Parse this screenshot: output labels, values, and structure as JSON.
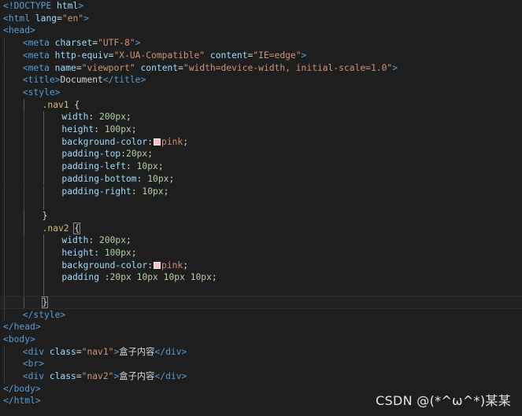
{
  "editor": {
    "theme_background": "#1e1e1e",
    "watermark": "CSDN @(*^ω^*)某某",
    "lines": [
      {
        "indent": 0,
        "tokens": [
          [
            "bracket",
            "<"
          ],
          [
            "doctype",
            "!DOCTYPE"
          ],
          [
            "txt",
            " "
          ],
          [
            "attr",
            "html"
          ],
          [
            "bracket",
            ">"
          ]
        ]
      },
      {
        "indent": 0,
        "tokens": [
          [
            "bracket",
            "<"
          ],
          [
            "tag",
            "html"
          ],
          [
            "txt",
            " "
          ],
          [
            "attr",
            "lang"
          ],
          [
            "txt",
            "="
          ],
          [
            "str",
            "\"en\""
          ],
          [
            "bracket",
            ">"
          ]
        ]
      },
      {
        "indent": 0,
        "tokens": [
          [
            "bracket",
            "<"
          ],
          [
            "tag",
            "head"
          ],
          [
            "bracket",
            ">"
          ]
        ]
      },
      {
        "indent": 1,
        "tokens": [
          [
            "bracket",
            "<"
          ],
          [
            "tag",
            "meta"
          ],
          [
            "txt",
            " "
          ],
          [
            "attr",
            "charset"
          ],
          [
            "txt",
            "="
          ],
          [
            "str",
            "\"UTF-8\""
          ],
          [
            "bracket",
            ">"
          ]
        ]
      },
      {
        "indent": 1,
        "tokens": [
          [
            "bracket",
            "<"
          ],
          [
            "tag",
            "meta"
          ],
          [
            "txt",
            " "
          ],
          [
            "attr",
            "http-equiv"
          ],
          [
            "txt",
            "="
          ],
          [
            "str",
            "\"X-UA-Compatible\""
          ],
          [
            "txt",
            " "
          ],
          [
            "attr",
            "content"
          ],
          [
            "txt",
            "="
          ],
          [
            "str",
            "\"IE=edge\""
          ],
          [
            "bracket",
            ">"
          ]
        ]
      },
      {
        "indent": 1,
        "tokens": [
          [
            "bracket",
            "<"
          ],
          [
            "tag",
            "meta"
          ],
          [
            "txt",
            " "
          ],
          [
            "attr",
            "name"
          ],
          [
            "txt",
            "="
          ],
          [
            "str",
            "\"viewport\""
          ],
          [
            "txt",
            " "
          ],
          [
            "attr",
            "content"
          ],
          [
            "txt",
            "="
          ],
          [
            "str",
            "\"width=device-width, initial-scale=1.0\""
          ],
          [
            "bracket",
            ">"
          ]
        ]
      },
      {
        "indent": 1,
        "tokens": [
          [
            "bracket",
            "<"
          ],
          [
            "tag",
            "title"
          ],
          [
            "bracket",
            ">"
          ],
          [
            "txt",
            "Document"
          ],
          [
            "bracket",
            "</"
          ],
          [
            "tag",
            "title"
          ],
          [
            "bracket",
            ">"
          ]
        ]
      },
      {
        "indent": 1,
        "tokens": [
          [
            "bracket",
            "<"
          ],
          [
            "tag",
            "style"
          ],
          [
            "bracket",
            ">"
          ]
        ]
      },
      {
        "indent": 2,
        "tokens": [
          [
            "sel",
            ".nav1"
          ],
          [
            "txt",
            " {"
          ]
        ]
      },
      {
        "indent": 3,
        "tokens": [
          [
            "prop",
            "width"
          ],
          [
            "txt",
            ": "
          ],
          [
            "num",
            "200px"
          ],
          [
            "txt",
            ";"
          ]
        ]
      },
      {
        "indent": 3,
        "tokens": [
          [
            "prop",
            "height"
          ],
          [
            "txt",
            ": "
          ],
          [
            "num",
            "100px"
          ],
          [
            "txt",
            ";"
          ]
        ]
      },
      {
        "indent": 3,
        "tokens": [
          [
            "prop",
            "background-color"
          ],
          [
            "txt",
            ":"
          ],
          [
            "swatch",
            "#ffc0cb"
          ],
          [
            "val",
            "pink"
          ],
          [
            "txt",
            ";"
          ]
        ]
      },
      {
        "indent": 3,
        "tokens": [
          [
            "prop",
            "padding-top"
          ],
          [
            "txt",
            ":"
          ],
          [
            "num",
            "20px"
          ],
          [
            "txt",
            ";"
          ]
        ]
      },
      {
        "indent": 3,
        "tokens": [
          [
            "prop",
            "padding-left"
          ],
          [
            "txt",
            ": "
          ],
          [
            "num",
            "10px"
          ],
          [
            "txt",
            ";"
          ]
        ]
      },
      {
        "indent": 3,
        "tokens": [
          [
            "prop",
            "padding-bottom"
          ],
          [
            "txt",
            ": "
          ],
          [
            "num",
            "10px"
          ],
          [
            "txt",
            ";"
          ]
        ]
      },
      {
        "indent": 3,
        "tokens": [
          [
            "prop",
            "padding-right"
          ],
          [
            "txt",
            ": "
          ],
          [
            "num",
            "10px"
          ],
          [
            "txt",
            ";"
          ]
        ]
      },
      {
        "indent": 3,
        "tokens": []
      },
      {
        "indent": 2,
        "tokens": [
          [
            "txt",
            "}"
          ]
        ]
      },
      {
        "indent": 2,
        "tokens": [
          [
            "sel",
            ".nav2"
          ],
          [
            "txt",
            " "
          ],
          [
            "match",
            "{"
          ]
        ]
      },
      {
        "indent": 3,
        "tokens": [
          [
            "prop",
            "width"
          ],
          [
            "txt",
            ": "
          ],
          [
            "num",
            "200px"
          ],
          [
            "txt",
            ";"
          ]
        ]
      },
      {
        "indent": 3,
        "tokens": [
          [
            "prop",
            "height"
          ],
          [
            "txt",
            ": "
          ],
          [
            "num",
            "100px"
          ],
          [
            "txt",
            ";"
          ]
        ]
      },
      {
        "indent": 3,
        "tokens": [
          [
            "prop",
            "background-color"
          ],
          [
            "txt",
            ":"
          ],
          [
            "swatch",
            "#ffc0cb"
          ],
          [
            "val",
            "pink"
          ],
          [
            "txt",
            ";"
          ]
        ]
      },
      {
        "indent": 3,
        "tokens": [
          [
            "prop",
            "padding"
          ],
          [
            "txt",
            " :"
          ],
          [
            "num",
            "20px"
          ],
          [
            "txt",
            " "
          ],
          [
            "num",
            "10px"
          ],
          [
            "txt",
            " "
          ],
          [
            "num",
            "10px"
          ],
          [
            "txt",
            " "
          ],
          [
            "num",
            "10px"
          ],
          [
            "txt",
            ";"
          ]
        ]
      },
      {
        "indent": 3,
        "tokens": []
      },
      {
        "indent": 2,
        "active": true,
        "tokens": [
          [
            "match",
            "}"
          ]
        ]
      },
      {
        "indent": 1,
        "tokens": [
          [
            "bracket",
            "</"
          ],
          [
            "tag",
            "style"
          ],
          [
            "bracket",
            ">"
          ]
        ]
      },
      {
        "indent": 0,
        "tokens": [
          [
            "bracket",
            "</"
          ],
          [
            "tag",
            "head"
          ],
          [
            "bracket",
            ">"
          ]
        ]
      },
      {
        "indent": 0,
        "tokens": [
          [
            "bracket",
            "<"
          ],
          [
            "tag",
            "body"
          ],
          [
            "bracket",
            ">"
          ]
        ]
      },
      {
        "indent": 1,
        "tokens": [
          [
            "bracket",
            "<"
          ],
          [
            "tag",
            "div"
          ],
          [
            "txt",
            " "
          ],
          [
            "attr",
            "class"
          ],
          [
            "txt",
            "="
          ],
          [
            "str",
            "\"nav1\""
          ],
          [
            "bracket",
            ">"
          ],
          [
            "txt",
            "盒子内容"
          ],
          [
            "bracket",
            "</"
          ],
          [
            "tag",
            "div"
          ],
          [
            "bracket",
            ">"
          ]
        ]
      },
      {
        "indent": 1,
        "tokens": [
          [
            "bracket",
            "<"
          ],
          [
            "tag",
            "br"
          ],
          [
            "bracket",
            ">"
          ]
        ]
      },
      {
        "indent": 1,
        "tokens": [
          [
            "bracket",
            "<"
          ],
          [
            "tag",
            "div"
          ],
          [
            "txt",
            " "
          ],
          [
            "attr",
            "class"
          ],
          [
            "txt",
            "="
          ],
          [
            "str",
            "\"nav2\""
          ],
          [
            "bracket",
            ">"
          ],
          [
            "txt",
            "盒子内容"
          ],
          [
            "bracket",
            "</"
          ],
          [
            "tag",
            "div"
          ],
          [
            "bracket",
            ">"
          ]
        ]
      },
      {
        "indent": 0,
        "tokens": [
          [
            "bracket",
            "</"
          ],
          [
            "tag",
            "body"
          ],
          [
            "bracket",
            ">"
          ]
        ]
      },
      {
        "indent": 0,
        "tokens": [
          [
            "bracket",
            "</"
          ],
          [
            "tag",
            "html"
          ],
          [
            "bracket",
            ">"
          ]
        ]
      }
    ]
  }
}
